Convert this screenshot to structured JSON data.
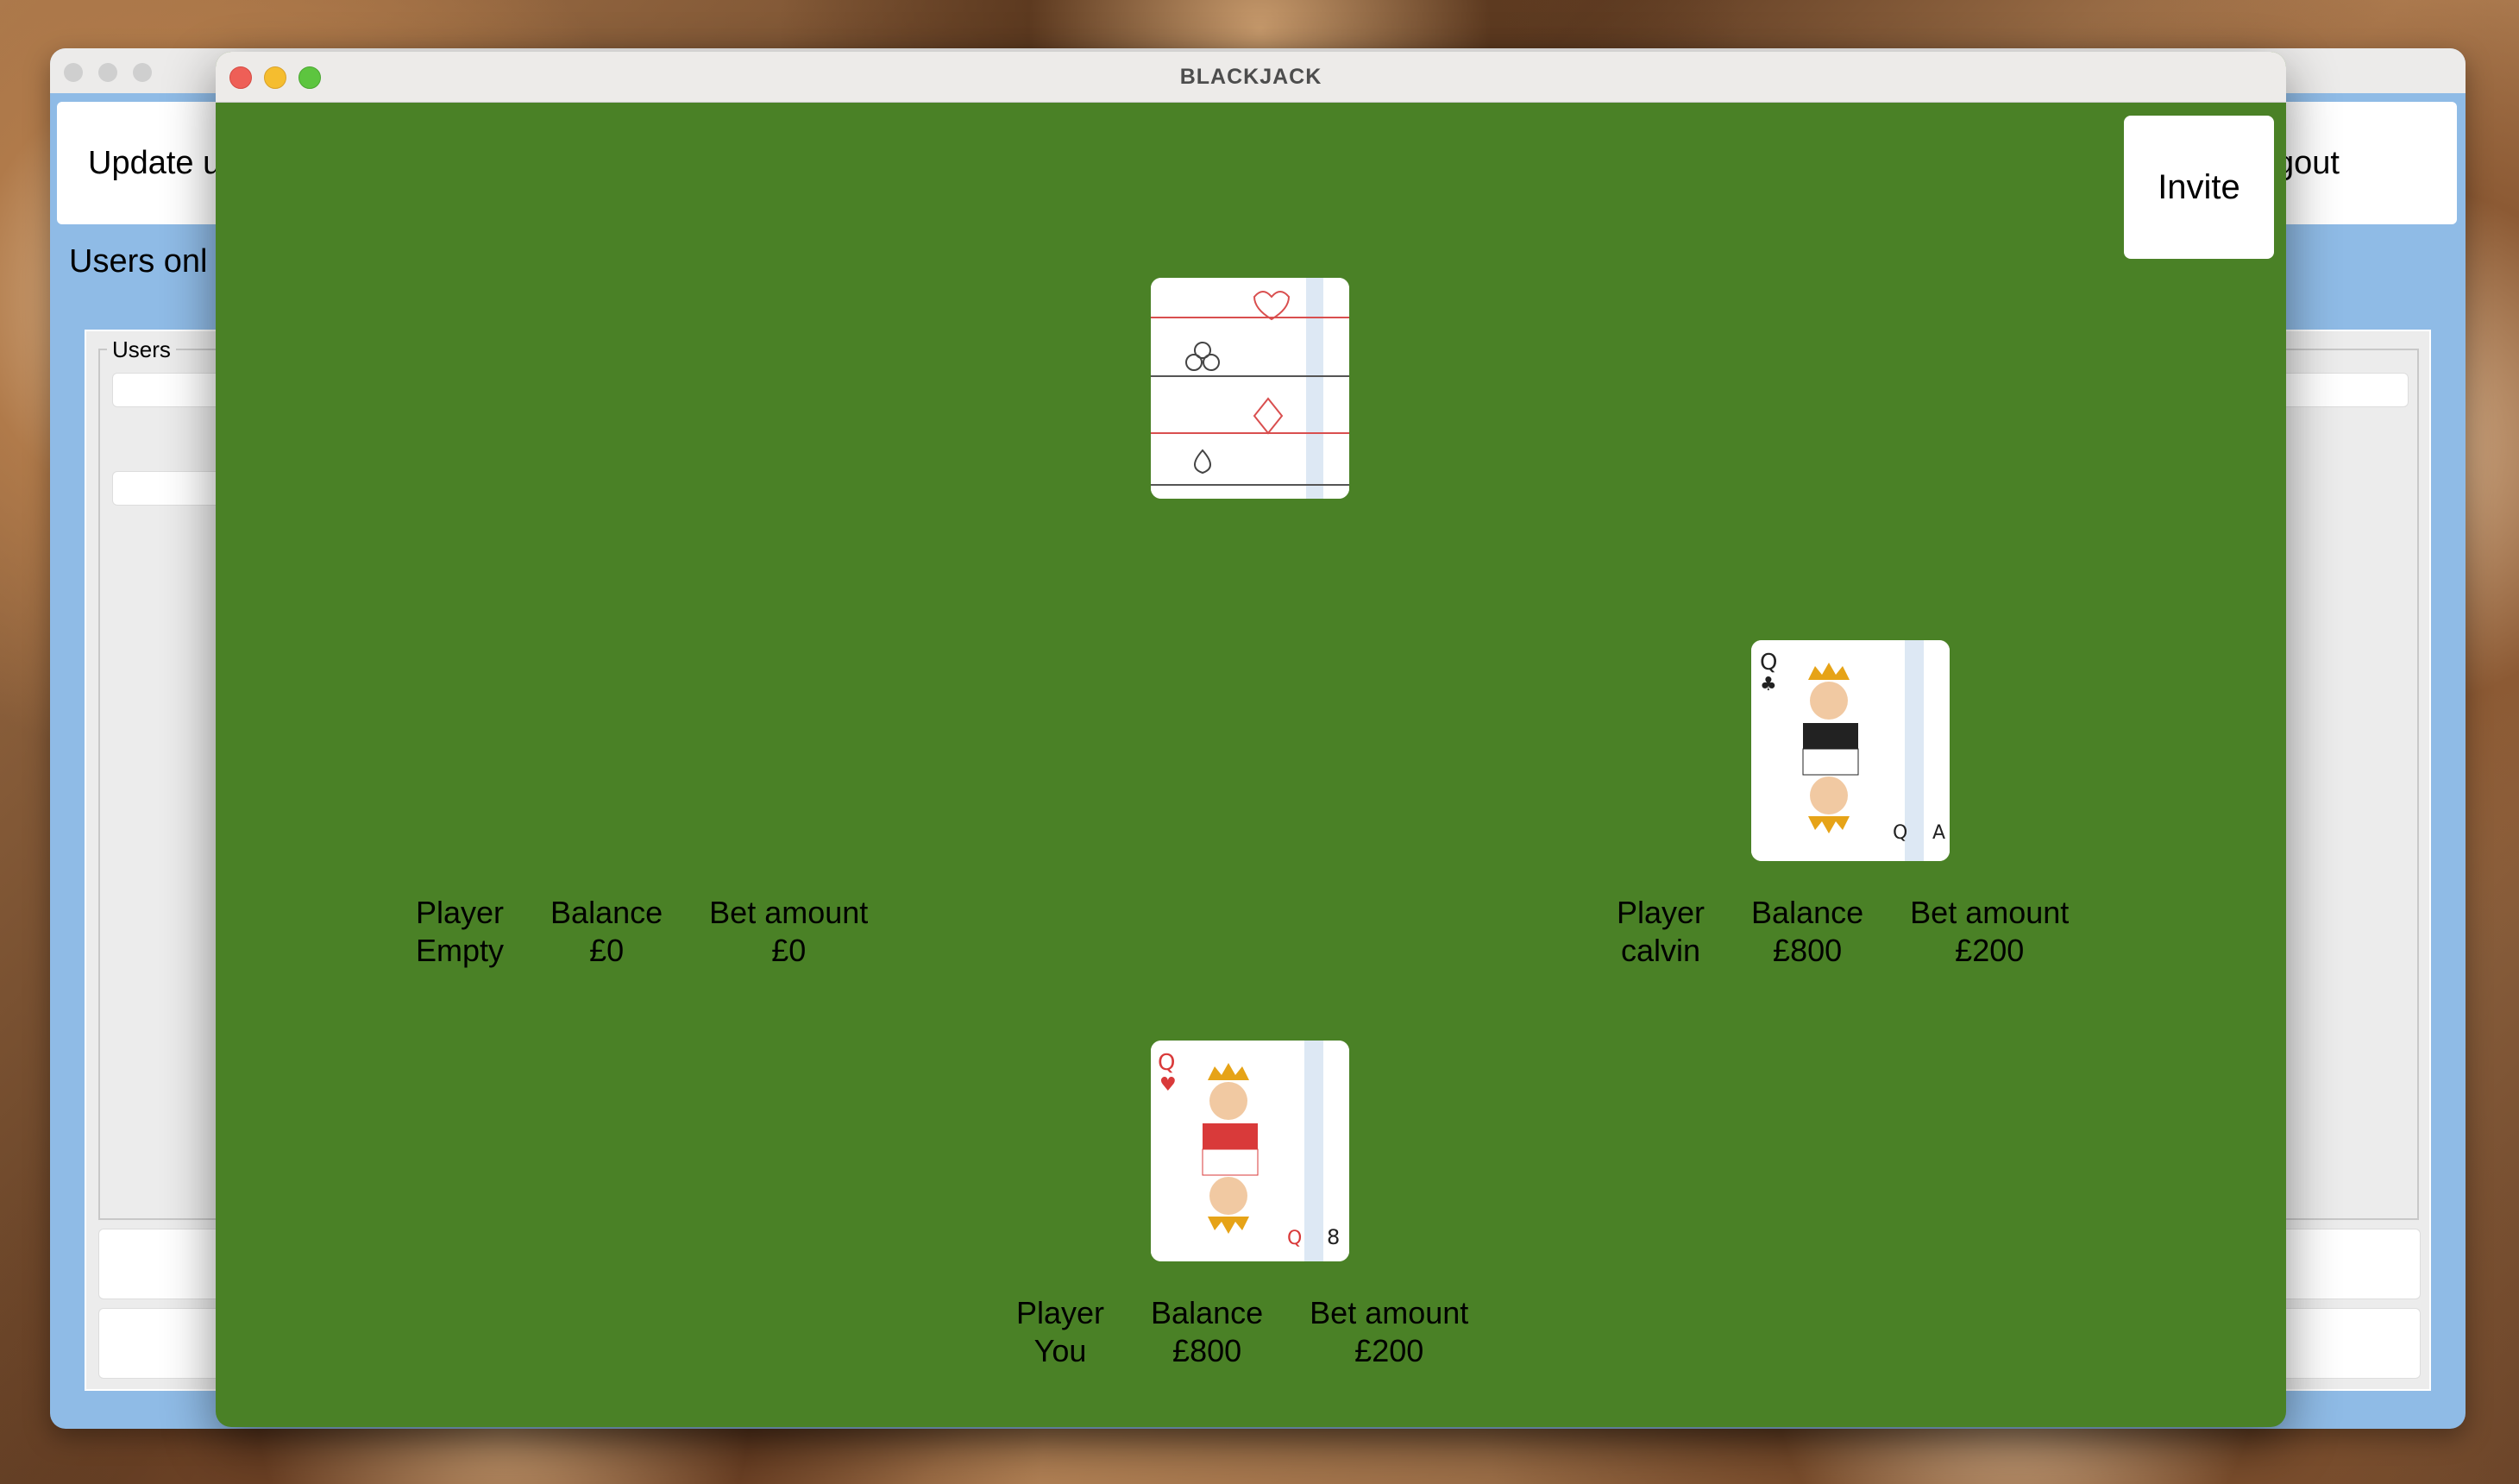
{
  "background_window": {
    "update_button_label": "Update u",
    "logout_button_label": "gout",
    "users_online_label": "Users onl",
    "users_group_label": "Users"
  },
  "window": {
    "title": "BLACKJACK",
    "invite_label": "Invite"
  },
  "dealer": {
    "cards": [
      "card-back"
    ]
  },
  "seats": [
    {
      "headers": {
        "player": "Player",
        "balance": "Balance",
        "bet": "Bet amount"
      },
      "player": "Empty",
      "balance": "£0",
      "bet": "£0",
      "cards": []
    },
    {
      "headers": {
        "player": "Player",
        "balance": "Balance",
        "bet": "Bet amount"
      },
      "player": "calvin",
      "balance": "£800",
      "bet": "£200",
      "cards": [
        {
          "rank": "Q",
          "suit": "♣"
        },
        {
          "rank": "A",
          "suit": "♣"
        }
      ]
    },
    {
      "headers": {
        "player": "Player",
        "balance": "Balance",
        "bet": "Bet amount"
      },
      "player": "You",
      "balance": "£800",
      "bet": "£200",
      "cards": [
        {
          "rank": "Q",
          "suit": "♥"
        },
        {
          "rank": "8",
          "suit": "♣"
        }
      ]
    }
  ],
  "colors": {
    "table_green": "#4a8126",
    "hearts_red": "#d93a3a",
    "clubs_black": "#222222"
  }
}
